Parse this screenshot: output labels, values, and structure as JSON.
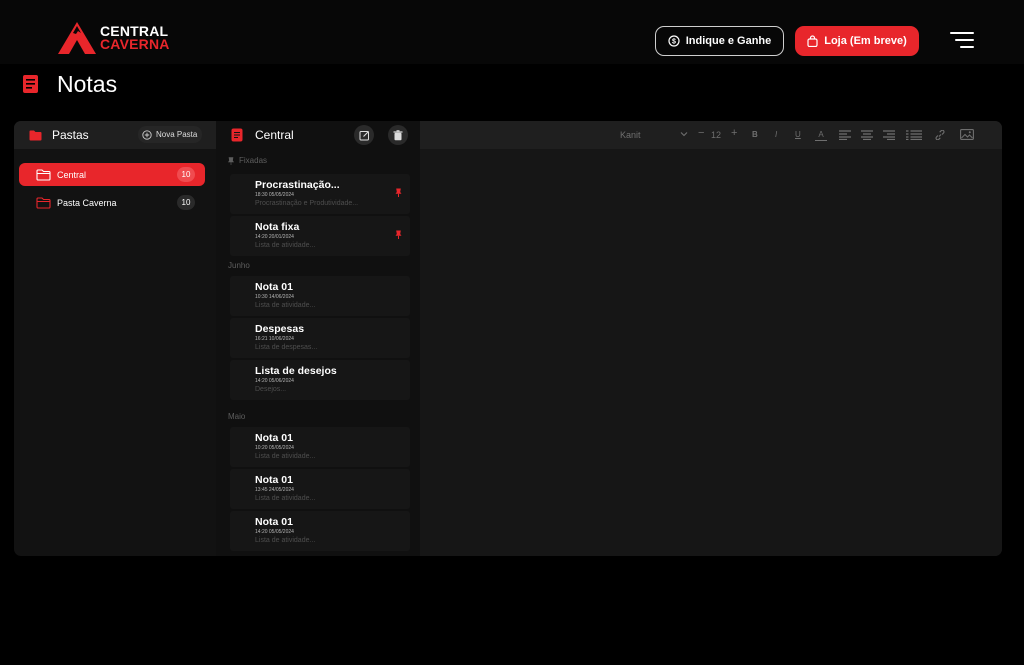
{
  "header": {
    "logo_line1": "CENTRAL",
    "logo_line2": "CAVERNA",
    "refer_label": "Indique e Ganhe",
    "store_label": "Loja (Em breve)",
    "brand_color": "#e8262b"
  },
  "page": {
    "title": "Notas"
  },
  "folders_panel": {
    "title": "Pastas",
    "new_folder_label": "Nova Pasta",
    "items": [
      {
        "label": "Central",
        "count": "10",
        "active": true
      },
      {
        "label": "Pasta Caverna",
        "count": "10",
        "active": false
      }
    ]
  },
  "notes_panel": {
    "title": "Central",
    "sections": [
      {
        "label": "Fixadas"
      },
      {
        "label": "Junho"
      },
      {
        "label": "Maio"
      }
    ],
    "notes": [
      {
        "title": "Procrastinação...",
        "meta": "18:30   05/05/2024",
        "preview": "Procrastinação e Produtividade...",
        "pinned": true
      },
      {
        "title": "Nota fixa",
        "meta": "14:20   20/01/2024",
        "preview": "Lista de atividade...",
        "pinned": true
      },
      {
        "title": "Nota 01",
        "meta": "10:30   14/06/2024",
        "preview": "Lista de atividade...",
        "pinned": false
      },
      {
        "title": "Despesas",
        "meta": "16:21   10/06/2024",
        "preview": "Lista de despesas...",
        "pinned": false
      },
      {
        "title": "Lista de desejos",
        "meta": "14:20   05/06/2024",
        "preview": "Desejos...",
        "pinned": false
      },
      {
        "title": "Nota 01",
        "meta": "10:20   05/05/2024",
        "preview": "Lista de atividade...",
        "pinned": false
      },
      {
        "title": "Nota 01",
        "meta": "13:45   24/05/2024",
        "preview": "Lista de atividade...",
        "pinned": false
      },
      {
        "title": "Nota 01",
        "meta": "14:20   05/05/2024",
        "preview": "Lista de atividade...",
        "pinned": false
      }
    ]
  },
  "editor_toolbar": {
    "font_family": "Kanit",
    "font_size": "12",
    "bold": "B",
    "italic": "I",
    "underline": "U",
    "text_color": "A"
  }
}
